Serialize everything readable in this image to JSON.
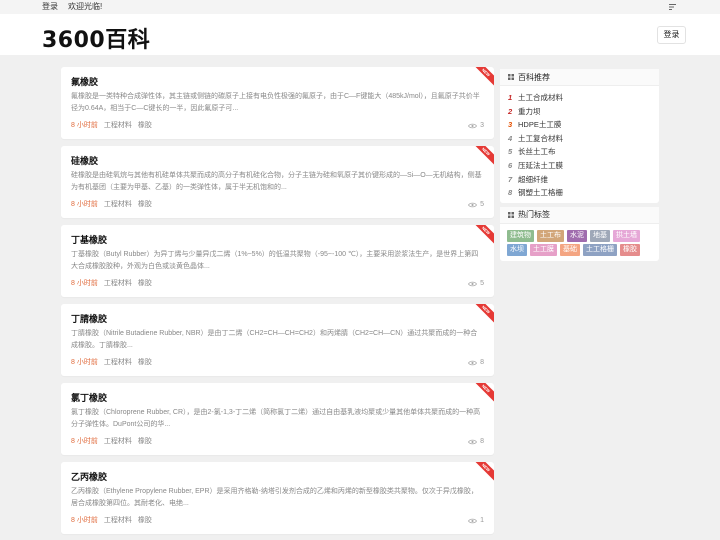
{
  "topbar": {
    "login": "登录",
    "welcome": "欢迎光临!"
  },
  "header": {
    "site_title": "3600百科",
    "login_button": "登录"
  },
  "articles": [
    {
      "title": "氟橡胶",
      "excerpt": "氟橡胶是一类特种合成弹性体，其主链或侧链的碳原子上接有电负性极强的氟原子，由于C—F键能大（485kJ/mol），且氟原子共价半径为0.64A，相当于C—C键长的一半，因此氟原子可...",
      "time": "8 小时前",
      "category": "工程材料",
      "tag": "橡胶",
      "views": "3",
      "badge": "NEW"
    },
    {
      "title": "硅橡胶",
      "excerpt": "硅橡胶是由硅氧烷与其他有机硅单体共聚而成的高分子有机硅化合物，分子主链为硅和氧原子其价键形成的—Si—O—无机结构，侧基为有机基团（主要为甲基、乙基）的一类弹性体，属于半无机饱和的...",
      "time": "8 小时前",
      "category": "工程材料",
      "tag": "橡胶",
      "views": "5",
      "badge": "NEW"
    },
    {
      "title": "丁基橡胶",
      "excerpt": "丁基橡胶（Butyl Rubber）为异丁烯与少量异戊二烯（1%~5%）的低温共聚物（-95~-100 ℃），主要采用淤浆法生产，是世界上第四大合成橡胶胶种，外观为白色或淡黄色晶体...",
      "time": "8 小时前",
      "category": "工程材料",
      "tag": "橡胶",
      "views": "5",
      "badge": "NEW"
    },
    {
      "title": "丁腈橡胶",
      "excerpt": "丁腈橡胶（Nitrile Butadiene Rubber, NBR）是由丁二烯（CH2=CH—CH=CH2）和丙烯腈（CH2=CH—CN）通过共聚而成的一种合成橡胶。丁腈橡胶...",
      "time": "8 小时前",
      "category": "工程材料",
      "tag": "橡胶",
      "views": "8",
      "badge": "NEW"
    },
    {
      "title": "氯丁橡胶",
      "excerpt": "氯丁橡胶（Chloroprene Rubber, CR），是由2-氯-1,3-丁二烯（简称氯丁二烯）通过自由基乳液均聚或少量其他单体共聚而成的一种高分子弹性体。DuPont公司的华...",
      "time": "8 小时前",
      "category": "工程材料",
      "tag": "橡胶",
      "views": "8",
      "badge": "NEW"
    },
    {
      "title": "乙丙橡胶",
      "excerpt": "乙丙橡胶（Ethylene Propylene Rubber, EPR）是采用齐格勒-纳塔引发剂合成的乙烯和丙烯的新型橡胶类共聚物。仅次于异戊橡胶，居合成橡胶第四位。其耐老化、电绝...",
      "time": "8 小时前",
      "category": "工程材料",
      "tag": "橡胶",
      "views": "1",
      "badge": "NEW"
    }
  ],
  "sidebar": {
    "recommend_title": "百科推荐",
    "recommend": [
      {
        "num": "1",
        "label": "土工合成材料",
        "color": "#c62828"
      },
      {
        "num": "2",
        "label": "重力坝",
        "color": "#c62828"
      },
      {
        "num": "3",
        "label": "HDPE土工膜",
        "color": "#e65100"
      },
      {
        "num": "4",
        "label": "土工复合材料",
        "color": "#888888"
      },
      {
        "num": "5",
        "label": "长丝土工布",
        "color": "#888888"
      },
      {
        "num": "6",
        "label": "压延法土工膜",
        "color": "#888888"
      },
      {
        "num": "7",
        "label": "超细纤维",
        "color": "#888888"
      },
      {
        "num": "8",
        "label": "钢塑土工格栅",
        "color": "#888888"
      }
    ],
    "tags_title": "热门标签",
    "tags": [
      {
        "label": "建筑物",
        "color": "#8fbc8f"
      },
      {
        "label": "土工布",
        "color": "#d2a679"
      },
      {
        "label": "水泥",
        "color": "#a06cae"
      },
      {
        "label": "地基",
        "color": "#9fa8b8"
      },
      {
        "label": "拱土墙",
        "color": "#e6a8d7"
      },
      {
        "label": "水坝",
        "color": "#7fa7d3"
      },
      {
        "label": "土工膜",
        "color": "#e6a0c8"
      },
      {
        "label": "基础",
        "color": "#f4a582"
      },
      {
        "label": "土工格栅",
        "color": "#8ea2c3"
      },
      {
        "label": "橡胶",
        "color": "#e58c8c"
      }
    ]
  }
}
